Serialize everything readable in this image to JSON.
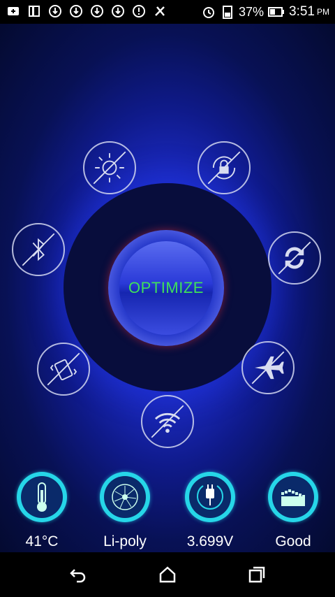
{
  "status_bar": {
    "battery_percent": "37%",
    "time": "3:51",
    "ampm": "PM"
  },
  "main": {
    "optimize_label": "OPTIMIZE"
  },
  "toggles": [
    {
      "name": "brightness-toggle",
      "icon": "brightness-icon",
      "state": "off"
    },
    {
      "name": "auto-rotate-toggle",
      "icon": "rotate-lock-icon",
      "state": "off"
    },
    {
      "name": "bluetooth-toggle",
      "icon": "bluetooth-icon",
      "state": "off"
    },
    {
      "name": "sync-toggle",
      "icon": "sync-icon",
      "state": "off"
    },
    {
      "name": "vibrate-toggle",
      "icon": "vibrate-icon",
      "state": "off"
    },
    {
      "name": "airplane-toggle",
      "icon": "airplane-icon",
      "state": "off"
    },
    {
      "name": "wifi-toggle",
      "icon": "wifi-icon",
      "state": "off"
    }
  ],
  "stats": {
    "temperature": "41°C",
    "battery_type": "Li-poly",
    "voltage": "3.699V",
    "health": "Good"
  },
  "colors": {
    "accent_cyan": "#26d6e8",
    "optimize_text": "#3fe05a",
    "ring_red": "#c8364a"
  }
}
